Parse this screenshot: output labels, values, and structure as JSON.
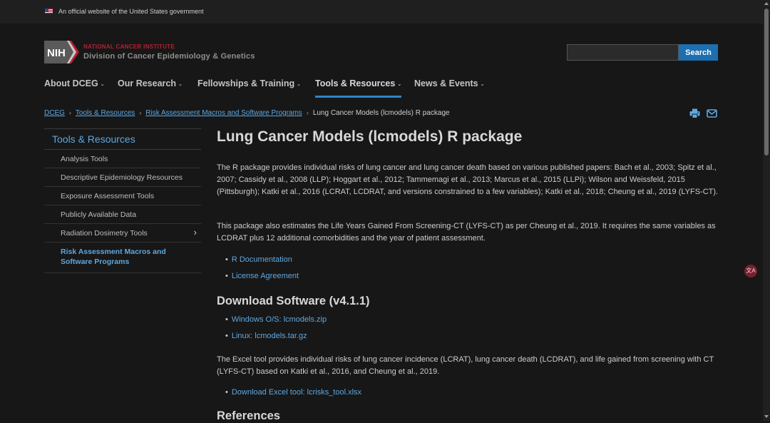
{
  "banner": {
    "text": "An official website of the United States government"
  },
  "header": {
    "logo_text": "NIH",
    "org_line1": "NATIONAL CANCER INSTITUTE",
    "org_line2": "Division of Cancer Epidemiology & Genetics"
  },
  "search": {
    "value": "",
    "button_label": "Search"
  },
  "nav": {
    "items": [
      {
        "label": "About DCEG"
      },
      {
        "label": "Our Research"
      },
      {
        "label": "Fellowships & Training"
      },
      {
        "label": "Tools & Resources"
      },
      {
        "label": "News & Events"
      }
    ],
    "active_index": 3
  },
  "breadcrumb": {
    "items": [
      "DCEG",
      "Tools & Resources",
      "Risk Assessment Macros and Software Programs"
    ],
    "current": "Lung Cancer Models (lcmodels) R package"
  },
  "sidebar": {
    "heading": "Tools & Resources",
    "items": [
      {
        "label": "Analysis Tools"
      },
      {
        "label": "Descriptive Epidemiology Resources"
      },
      {
        "label": "Exposure Assessment Tools"
      },
      {
        "label": "Publicly Available Data"
      },
      {
        "label": "Radiation Dosimetry Tools",
        "expandable": true
      },
      {
        "label": "Risk Assessment Macros and Software Programs",
        "active": true
      }
    ]
  },
  "main": {
    "title": "Lung Cancer Models (lcmodels) R package",
    "intro": "The R package provides individual risks of lung cancer and lung cancer death based on various published papers: Bach et al., 2003; Spitz et al., 2007; Cassidy et al., 2008 (LLP); Hoggart et al., 2012; Tammemagi et al., 2013; Marcus et al., 2015 (LLPi); Wilson and Weissfeld, 2015 (Pittsburgh); Katki et al., 2016 (LCRAT, LCDRAT, and versions constrained to a few variables); Katki et al., 2018; Cheung et al., 2019 (LYFS-CT).",
    "para2": "This package also estimates the Life Years Gained From Screening-CT (LYFS-CT) as per Cheung et al., 2019. It requires the same variables as LCDRAT plus 12 additional comorbidities and the year of patient assessment.",
    "links1": [
      "R Documentation",
      "License Agreement"
    ],
    "download_heading": "Download Software (v4.1.1)",
    "download_links": [
      "Windows O/S: lcmodels.zip",
      "Linux: lcmodels.tar.gz"
    ],
    "para3": "The Excel tool provides individual risks of lung cancer incidence (LCRAT), lung cancer death (LCDRAT), and life gained from screening with CT (LYFS-CT) based on Katki et al., 2016, and Cheung et al., 2019.",
    "excel_link": "Download Excel tool: lcrisks_tool.xlsx",
    "references_heading": "References"
  },
  "colors": {
    "background": "#171717",
    "link": "#5fa8e0",
    "accent_blue": "#1d6fb0",
    "nci_red": "#b8202f"
  },
  "icons": [
    "us-flag-icon",
    "print-icon",
    "email-icon",
    "chevron-down-icon",
    "chevron-right-icon",
    "translate-icon"
  ]
}
